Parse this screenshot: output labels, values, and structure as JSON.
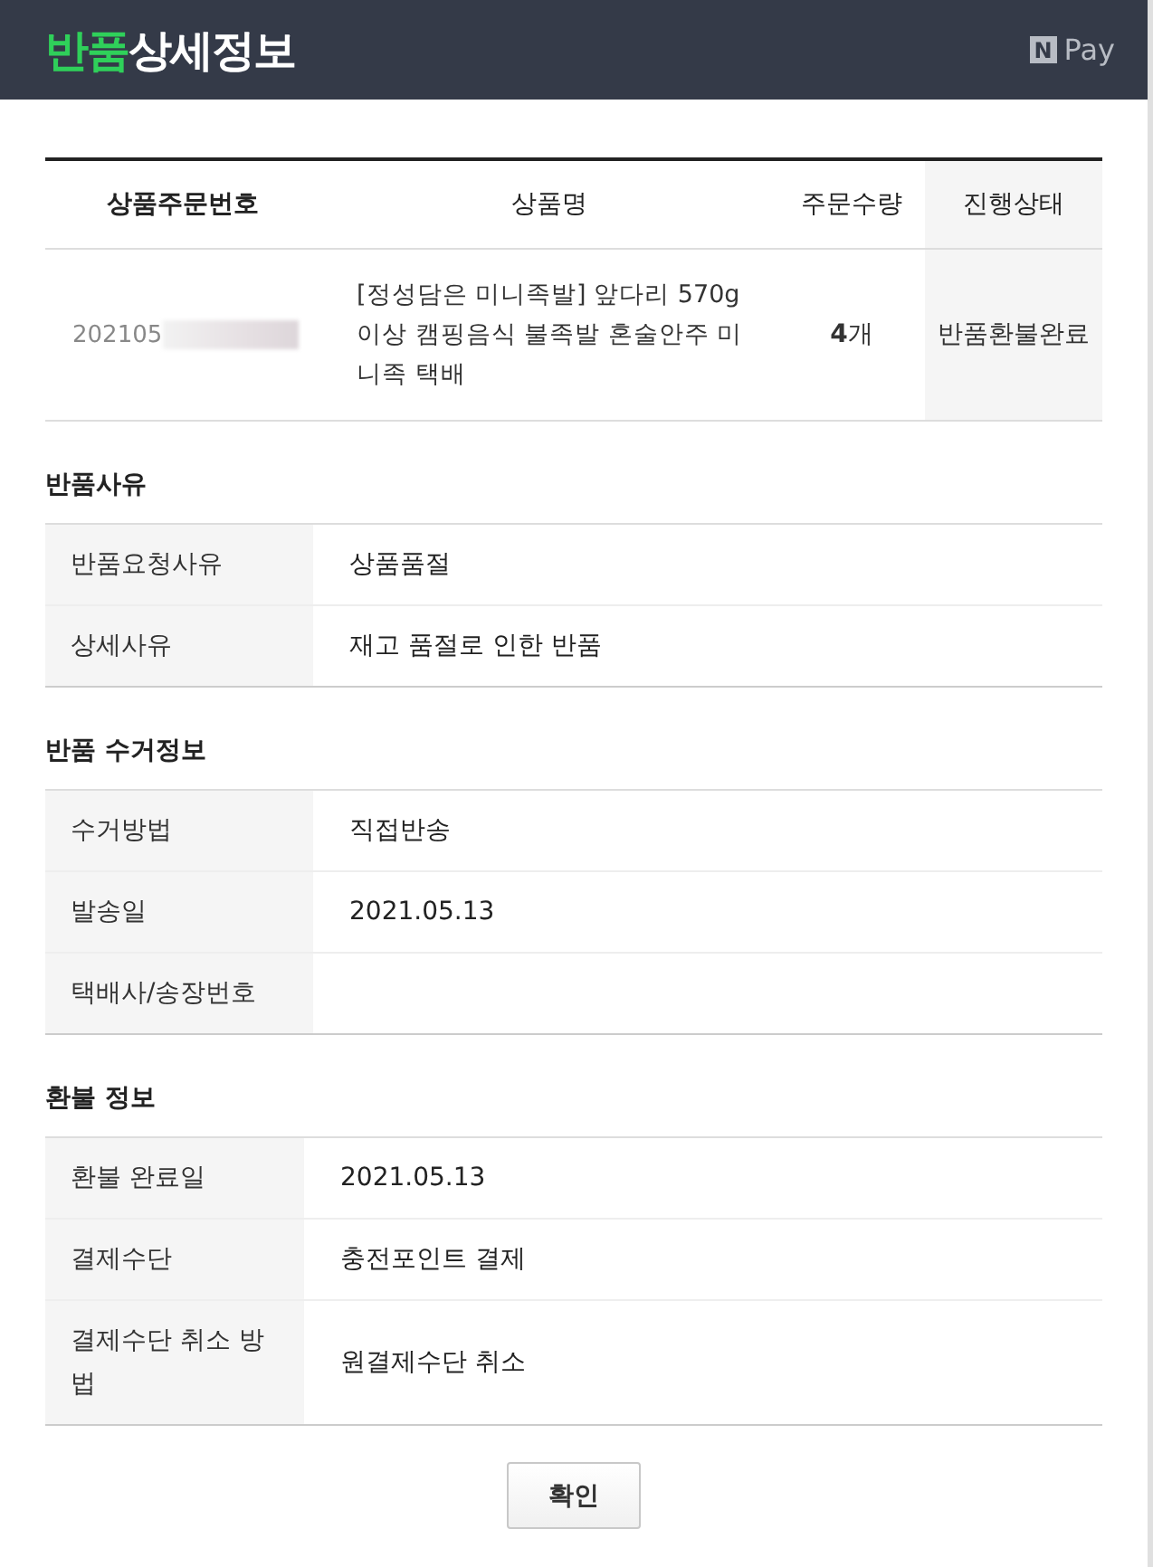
{
  "header": {
    "title_highlight": "반품",
    "title_rest": "상세정보",
    "pay_badge": "N",
    "pay_label": "Pay"
  },
  "order_table": {
    "columns": [
      "상품주문번호",
      "상품명",
      "주문수량",
      "진행상태"
    ],
    "row": {
      "order_number": "202105",
      "order_number_redacted": true,
      "product_name": "[정성담은 미니족발] 앞다리 570g 이상 캠핑음식 불족발 혼술안주 미니족 택배",
      "quantity": "**4**개",
      "status": "반품환불완료"
    }
  },
  "sections": [
    {
      "title": "반품사유",
      "rows": [
        {
          "label": "반품요청사유",
          "value": "상품품절"
        },
        {
          "label": "상세사유",
          "value": "재고 품절로 인한 반품"
        }
      ]
    },
    {
      "title": "반품 수거정보",
      "rows": [
        {
          "label": "수거방법",
          "value": "직접반송"
        },
        {
          "label": "발송일",
          "value": "2021.05.13"
        },
        {
          "label": "택배사/송장번호"
        }
      ]
    },
    {
      "title": "환불 정보",
      "rows": [
        {
          "label": "환불 완료일",
          "value": "2021.05.13"
        },
        {
          "label": "결제수단",
          "value": "충전포인트 결제"
        },
        {
          "label": "결제수단 취소 방법",
          "value": "원결제수단 취소"
        }
      ]
    }
  ],
  "confirm_button": "확인"
}
